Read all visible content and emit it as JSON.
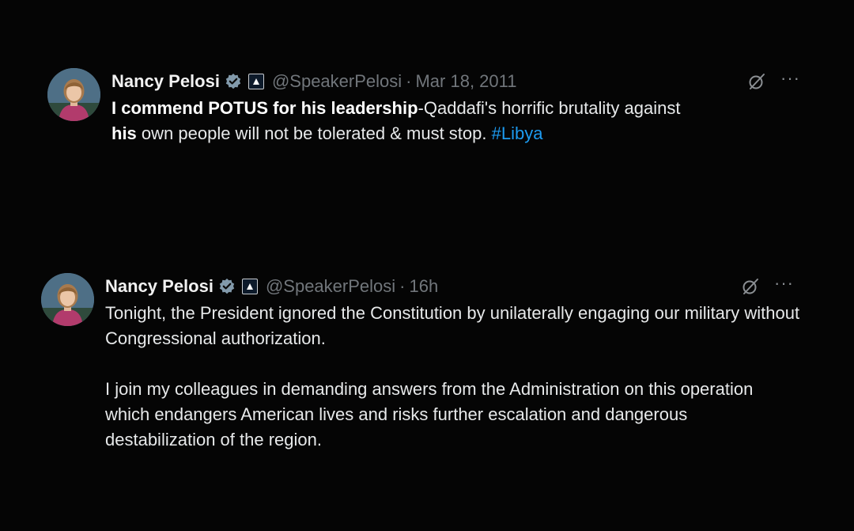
{
  "tweets": [
    {
      "author": {
        "name": "Nancy Pelosi",
        "handle": "@SpeakerPelosi",
        "verified_icon": "verified-badge-icon",
        "affiliation_icon": "government-badge-icon"
      },
      "separator": "·",
      "timestamp": "Mar 18, 2011",
      "text": {
        "bold_1": "I commend POTUS for his leadership",
        "plain_1": "-Qaddafi's horrific brutality against",
        "bold_2": "his",
        "plain_2": " own people will not be tolerated & must stop. ",
        "hashtag": "#Libya"
      }
    },
    {
      "author": {
        "name": "Nancy Pelosi",
        "handle": "@SpeakerPelosi",
        "verified_icon": "verified-badge-icon",
        "affiliation_icon": "government-badge-icon"
      },
      "separator": "·",
      "timestamp": "16h",
      "paragraphs": [
        "Tonight, the President ignored the Constitution by unilaterally engaging our military without Congressional authorization.",
        "I join my colleagues in demanding answers from the Administration on this operation which endangers American lives and risks further escalation and dangerous destabilization of the region."
      ]
    }
  ],
  "icons": {
    "grok": "grok-icon",
    "more": "more-options-icon",
    "more_glyph": "···"
  },
  "colors": {
    "background": "#000000",
    "text": "#e7e9ea",
    "muted": "#71767b",
    "link": "#1d9bf0",
    "verified": "#829aab"
  }
}
